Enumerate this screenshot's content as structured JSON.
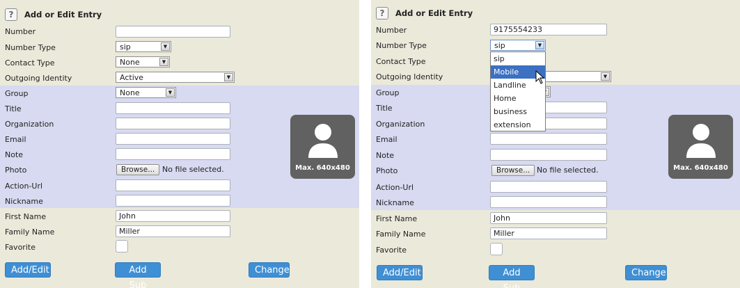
{
  "form": {
    "title": "Add or Edit Entry",
    "help_glyph": "?",
    "labels": {
      "number": "Number",
      "number_type": "Number Type",
      "contact_type": "Contact Type",
      "outgoing_identity": "Outgoing Identity",
      "group": "Group",
      "title": "Title",
      "organization": "Organization",
      "email": "Email",
      "note": "Note",
      "photo": "Photo",
      "action_url": "Action-Url",
      "nickname": "Nickname",
      "first_name": "First Name",
      "family_name": "Family Name",
      "favorite": "Favorite"
    },
    "browse_label": "Browse...",
    "file_status": "No file selected.",
    "photo_caption": "Max. 640x480",
    "buttons": {
      "add_edit": "Add/Edit",
      "add_sub": "Add Sub",
      "change": "Change"
    }
  },
  "left": {
    "number": "",
    "number_type": "sip",
    "contact_type": "None",
    "outgoing_identity": "Active",
    "group": "None",
    "first_name": "John",
    "family_name": "Miller"
  },
  "right": {
    "number": "9175554233",
    "number_type": "sip",
    "first_name": "John",
    "family_name": "Miller",
    "dropdown_options": [
      "sip",
      "Mobile",
      "Landline",
      "Home",
      "business",
      "extension"
    ],
    "dropdown_highlighted": "Mobile"
  },
  "colors": {
    "panel_bg": "#ebe9da",
    "band_bg": "#d7daf0",
    "button_bg": "#3f8fd4",
    "photo_bg": "#616161"
  }
}
